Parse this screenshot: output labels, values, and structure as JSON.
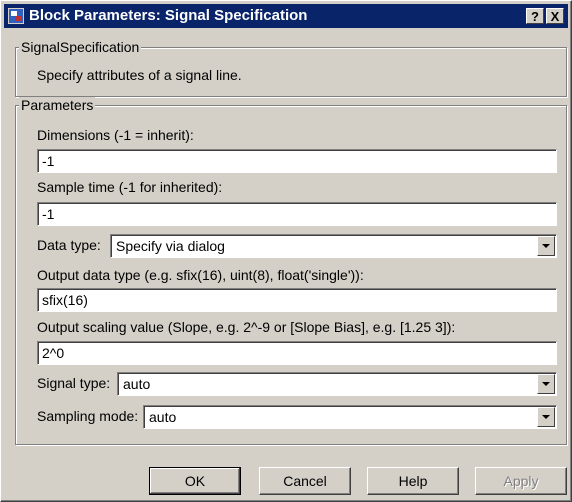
{
  "window": {
    "title": "Block Parameters: Signal Specification",
    "help_glyph": "?",
    "close_glyph": "X"
  },
  "signal_group": {
    "legend": "SignalSpecification",
    "description": "Specify attributes of a signal line."
  },
  "params_group": {
    "legend": "Parameters",
    "dimensions_label": "Dimensions (-1 = inherit):",
    "dimensions_value": "-1",
    "sample_time_label": "Sample time (-1 for inherited):",
    "sample_time_value": "-1",
    "data_type_label": "Data type:",
    "data_type_value": "Specify via dialog",
    "output_data_type_label": "Output data type (e.g. sfix(16), uint(8), float('single')):",
    "output_data_type_value": "sfix(16)",
    "output_scaling_label": "Output scaling value (Slope, e.g. 2^-9 or [Slope Bias], e.g. [1.25 3]):",
    "output_scaling_value": "2^0",
    "signal_type_label": "Signal type:",
    "signal_type_value": "auto",
    "sampling_mode_label": "Sampling mode:",
    "sampling_mode_value": "auto"
  },
  "buttons": {
    "ok": "OK",
    "cancel": "Cancel",
    "help": "Help",
    "apply": "Apply"
  },
  "colors": {
    "titlebar": "#0a246a",
    "dialog_face": "#d4d0c8"
  }
}
